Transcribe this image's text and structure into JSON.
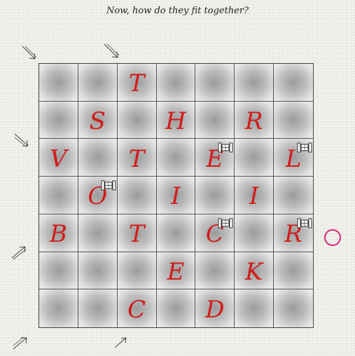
{
  "title": "Now, how do they fit together?",
  "colors": {
    "letter": "#d21c1c",
    "grid_line": "#555555",
    "circle_marker": "#d4287a"
  },
  "board": {
    "rows": 7,
    "cols": 7,
    "cells": [
      [
        "",
        "",
        "T",
        "",
        "",
        "",
        ""
      ],
      [
        "",
        "S",
        "",
        "H",
        "",
        "R",
        ""
      ],
      [
        "V",
        "",
        "T",
        "",
        "E",
        "",
        "L"
      ],
      [
        "",
        "O",
        "",
        "I",
        "",
        "I",
        ""
      ],
      [
        "B",
        "",
        "T",
        "",
        "C",
        "",
        "R"
      ],
      [
        "",
        "",
        "",
        "E",
        "",
        "K",
        ""
      ],
      [
        "",
        "",
        "C",
        "",
        "D",
        "",
        ""
      ]
    ],
    "pieces": [
      {
        "row": 2,
        "col": 4,
        "icon": "train-car-icon"
      },
      {
        "row": 2,
        "col": 6,
        "icon": "train-car-icon"
      },
      {
        "row": 3,
        "col": 1,
        "icon": "train-car-icon"
      },
      {
        "row": 4,
        "col": 4,
        "icon": "train-car-icon"
      },
      {
        "row": 4,
        "col": 6,
        "icon": "train-car-icon"
      }
    ]
  },
  "arrows": [
    "arrow-icon",
    "arrow-icon",
    "arrow-icon",
    "arrow-icon",
    "arrow-icon",
    "arrow-icon"
  ],
  "marker": "circle-marker"
}
